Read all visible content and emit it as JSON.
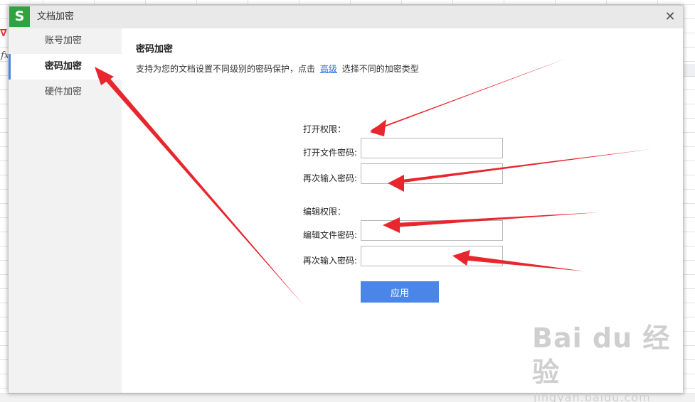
{
  "dialog": {
    "title": "文档加密",
    "logo_letter": "S",
    "close_glyph": "✕"
  },
  "sidebar": {
    "items": [
      {
        "label": "账号加密",
        "active": false
      },
      {
        "label": "密码加密",
        "active": true
      },
      {
        "label": "硬件加密",
        "active": false
      }
    ]
  },
  "main": {
    "title": "密码加密",
    "desc_before": "支持为您的文档设置不同级别的密码保护，点击",
    "desc_link": "高级",
    "desc_after": "选择不同的加密类型",
    "open_section": "打开权限：",
    "open_password_label": "打开文件密码:",
    "open_confirm_label": "再次输入密码:",
    "edit_section": "编辑权限：",
    "edit_password_label": "编辑文件密码:",
    "edit_confirm_label": "再次输入密码:",
    "apply_label": "应用"
  },
  "background": {
    "fx_label": "fx"
  },
  "watermark": {
    "logo": "Bai du 经验",
    "url": "jingyan.baidu.com"
  },
  "colors": {
    "accent": "#4a86e8",
    "link": "#2a6fd6",
    "logo_green": "#2fa241",
    "arrow_red": "#e8262d"
  }
}
